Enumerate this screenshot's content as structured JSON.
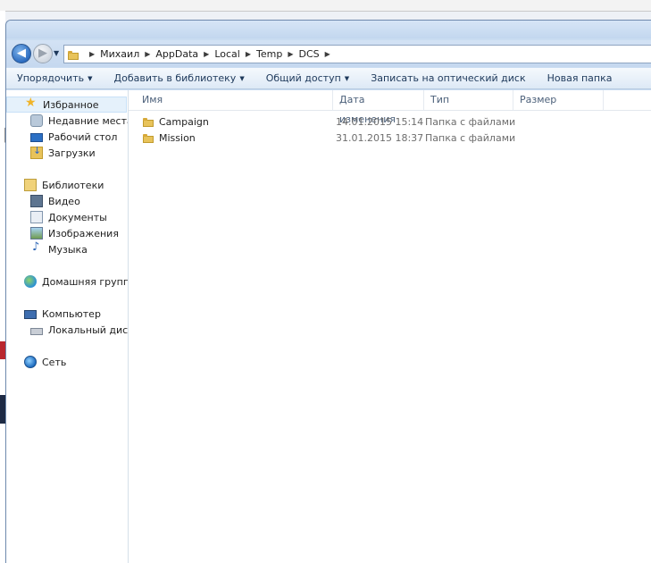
{
  "window": {
    "breadcrumb": [
      "Михаил",
      "AppData",
      "Local",
      "Temp",
      "DCS"
    ]
  },
  "toolbar": {
    "organize": "Упорядочить",
    "add_to_library": "Добавить в библиотеку",
    "share": "Общий доступ",
    "burn": "Записать на оптический диск",
    "new_folder": "Новая папка"
  },
  "sidebar": {
    "favorites": "Избранное",
    "recent": "Недавние места",
    "desktop": "Рабочий стол",
    "downloads": "Загрузки",
    "libraries": "Библиотеки",
    "video": "Видео",
    "documents": "Документы",
    "images": "Изображения",
    "music": "Музыка",
    "homegroup": "Домашняя группа",
    "computer": "Компьютер",
    "local_disk": "Локальный диск (C:",
    "network": "Сеть"
  },
  "columns": {
    "name": "Имя",
    "date": "Дата изменения",
    "type": "Тип",
    "size": "Размер"
  },
  "files": [
    {
      "name": "Campaign",
      "date": "14.01.2015 15:14",
      "type": "Папка с файлами"
    },
    {
      "name": "Mission",
      "date": "31.01.2015 18:37",
      "type": "Папка с файлами"
    }
  ],
  "icons": {
    "back": "back-arrow-icon",
    "forward": "forward-arrow-icon",
    "folder": "folder-icon"
  }
}
